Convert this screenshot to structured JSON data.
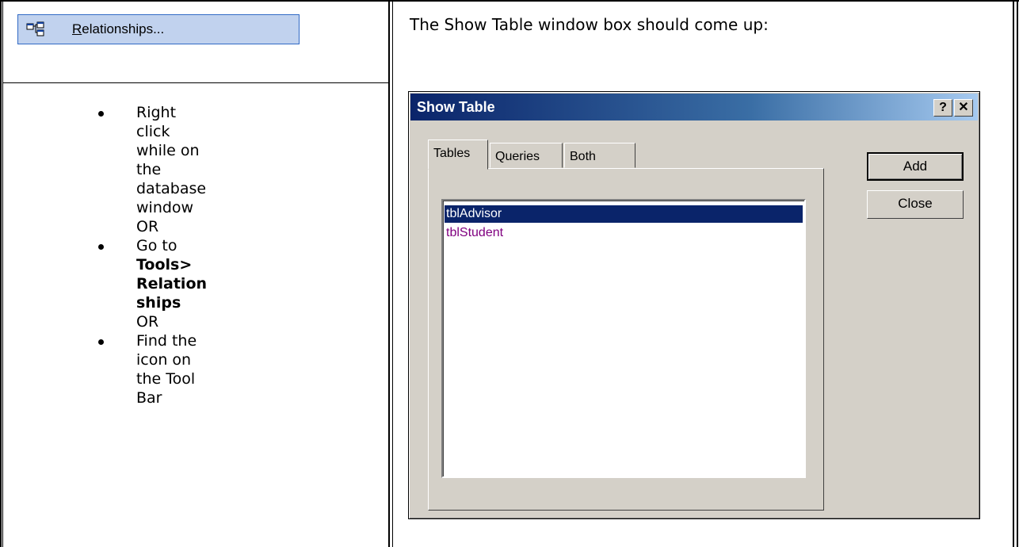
{
  "menu": {
    "relationships_label_mnemonic": "R",
    "relationships_label_rest": "elationships..."
  },
  "instructions": {
    "bullet1": [
      "Right",
      "click",
      "while on",
      "the",
      "database",
      "window"
    ],
    "bullet1_or": "OR",
    "bullet2_plain": "Go to",
    "bullet2_bold": [
      "Tools>",
      "Relation",
      "ships"
    ],
    "bullet2_or": "OR",
    "bullet3": [
      "Find the",
      "icon on",
      "the Tool",
      "Bar"
    ]
  },
  "caption": "The Show Table window box should come up:",
  "dialog": {
    "title": "Show Table",
    "help_button": "?",
    "close_button": "✕",
    "tabs": [
      "Tables",
      "Queries",
      "Both"
    ],
    "active_tab": "Tables",
    "list_items": [
      "tblAdvisor",
      "tblStudent"
    ],
    "selected_item": "tblAdvisor",
    "add_button": "Add",
    "close_action_button": "Close"
  },
  "colors": {
    "selection": "#0a246a",
    "unselected_item": "#800080",
    "menu_highlight": "#c1d2ee"
  }
}
